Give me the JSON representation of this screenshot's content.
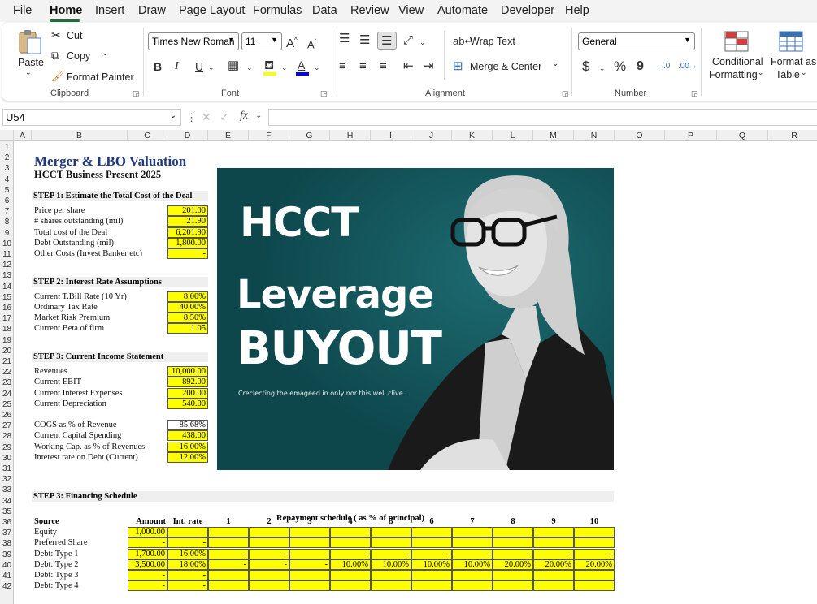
{
  "menu": [
    "File",
    "Home",
    "Insert",
    "Draw",
    "Page Layout",
    "Formulas",
    "Data",
    "Review",
    "View",
    "Automate",
    "Developer",
    "Help"
  ],
  "clipboard": {
    "paste": "Paste",
    "cut": "Cut",
    "copy": "Copy",
    "painter": "Format Painter",
    "group": "Clipboard"
  },
  "font": {
    "name": "Times New Roman",
    "size": "11",
    "group": "Font",
    "bold": "B",
    "italic": "I",
    "underline": "U"
  },
  "alignment": {
    "wrap": "Wrap Text",
    "merge": "Merge & Center",
    "group": "Alignment"
  },
  "number": {
    "format": "General",
    "group": "Number",
    "currency": "$",
    "percent": "%",
    "comma": "9"
  },
  "styles": {
    "conditional1": "Conditional",
    "conditional2": "Formatting",
    "table1": "Format as",
    "table2": "Table"
  },
  "namebox": "U54",
  "fx": "fx",
  "columns": [
    "A",
    "B",
    "C",
    "D",
    "E",
    "F",
    "G",
    "H",
    "I",
    "J",
    "K",
    "L",
    "M",
    "N",
    "O",
    "P",
    "Q",
    "R"
  ],
  "sheet": {
    "title": "Merger & LBO Valuation",
    "subtitle": "HCCT Business Present 2025",
    "step1": "STEP 1: Estimate the Total Cost of the Deal",
    "step1_rows": [
      {
        "label": "Price per share",
        "value": "201.00"
      },
      {
        "label": "# shares outstanding (mil)",
        "value": "21.90"
      },
      {
        "label": "Total cost of the Deal",
        "value": "6,201.90"
      },
      {
        "label": "Debt Outstanding (mil)",
        "value": "1,800.00"
      },
      {
        "label": "Other Costs (Invest Banker etc)",
        "value": "-"
      }
    ],
    "step2": "STEP 2: Interest Rate Assumptions",
    "step2_rows": [
      {
        "label": "Current T.Bill Rate (10 Yr)",
        "value": "8.00%"
      },
      {
        "label": "Ordinary Tax Rate",
        "value": "40.00%"
      },
      {
        "label": "Market Risk Premium",
        "value": "8.50%"
      },
      {
        "label": "Current Beta of firm",
        "value": "1.05"
      }
    ],
    "step3": "STEP 3: Current Income Statement",
    "step3_rows": [
      {
        "label": "Revenues",
        "value": "10,000.00"
      },
      {
        "label": "Current EBIT",
        "value": "892.00"
      },
      {
        "label": "Current Interest Expenses",
        "value": "200.00"
      },
      {
        "label": "Current Depreciation",
        "value": "540.00"
      }
    ],
    "step3b_rows": [
      {
        "label": "COGS as % of Revenue",
        "value": "85.68%"
      },
      {
        "label": "Current Capital Spending",
        "value": "438.00"
      },
      {
        "label": "Working Cap. as % of Revenues",
        "value": "16.00%"
      },
      {
        "label": "Interest rate on Debt (Current)",
        "value": "12.00%"
      }
    ],
    "step3_fin": "STEP 3: Financing Schedule",
    "repay_title": "Repayment schedule ( as % of principal)",
    "fin_headers": [
      "Source",
      "Amount",
      "Int. rate",
      "1",
      "2",
      "3",
      "4",
      "5",
      "6",
      "7",
      "8",
      "9",
      "10"
    ],
    "fin_rows": [
      {
        "source": "Equity",
        "amount": "1,000.00",
        "rate": "",
        "years": [
          "",
          "",
          "",
          "",
          "",
          "",
          "",
          "",
          "",
          ""
        ]
      },
      {
        "source": "Preferred Share",
        "amount": "-",
        "rate": "-",
        "years": [
          "",
          "",
          "",
          "",
          "",
          "",
          "",
          "",
          "",
          ""
        ]
      },
      {
        "source": "Debt: Type 1",
        "amount": "1,700.00",
        "rate": "16.00%",
        "years": [
          "-",
          "-",
          "-",
          "-",
          "-",
          "-",
          "-",
          "-",
          "-",
          "-"
        ]
      },
      {
        "source": "Debt: Type 2",
        "amount": "3,500.00",
        "rate": "18.00%",
        "years": [
          "-",
          "-",
          "-",
          "10.00%",
          "10.00%",
          "10.00%",
          "10.00%",
          "20.00%",
          "20.00%",
          "20.00%"
        ]
      },
      {
        "source": "Debt: Type 3",
        "amount": "-",
        "rate": "-",
        "years": [
          "",
          "",
          "",
          "",
          "",
          "",
          "",
          "",
          "",
          ""
        ]
      },
      {
        "source": "Debt: Type 4",
        "amount": "-",
        "rate": "-",
        "years": [
          "",
          "",
          "",
          "",
          "",
          "",
          "",
          "",
          "",
          ""
        ]
      }
    ]
  },
  "banner": {
    "line1": "HCCT",
    "line2": "Leverage",
    "line3": "BUYOUT",
    "tagline": "Creclecting the emageed in only nor this well clive."
  },
  "colors": {
    "accent": "#1e6e3b",
    "banner_bg": "#0f5056",
    "input_fill": "#ffff00",
    "title_blue": "#1f3a7a"
  }
}
